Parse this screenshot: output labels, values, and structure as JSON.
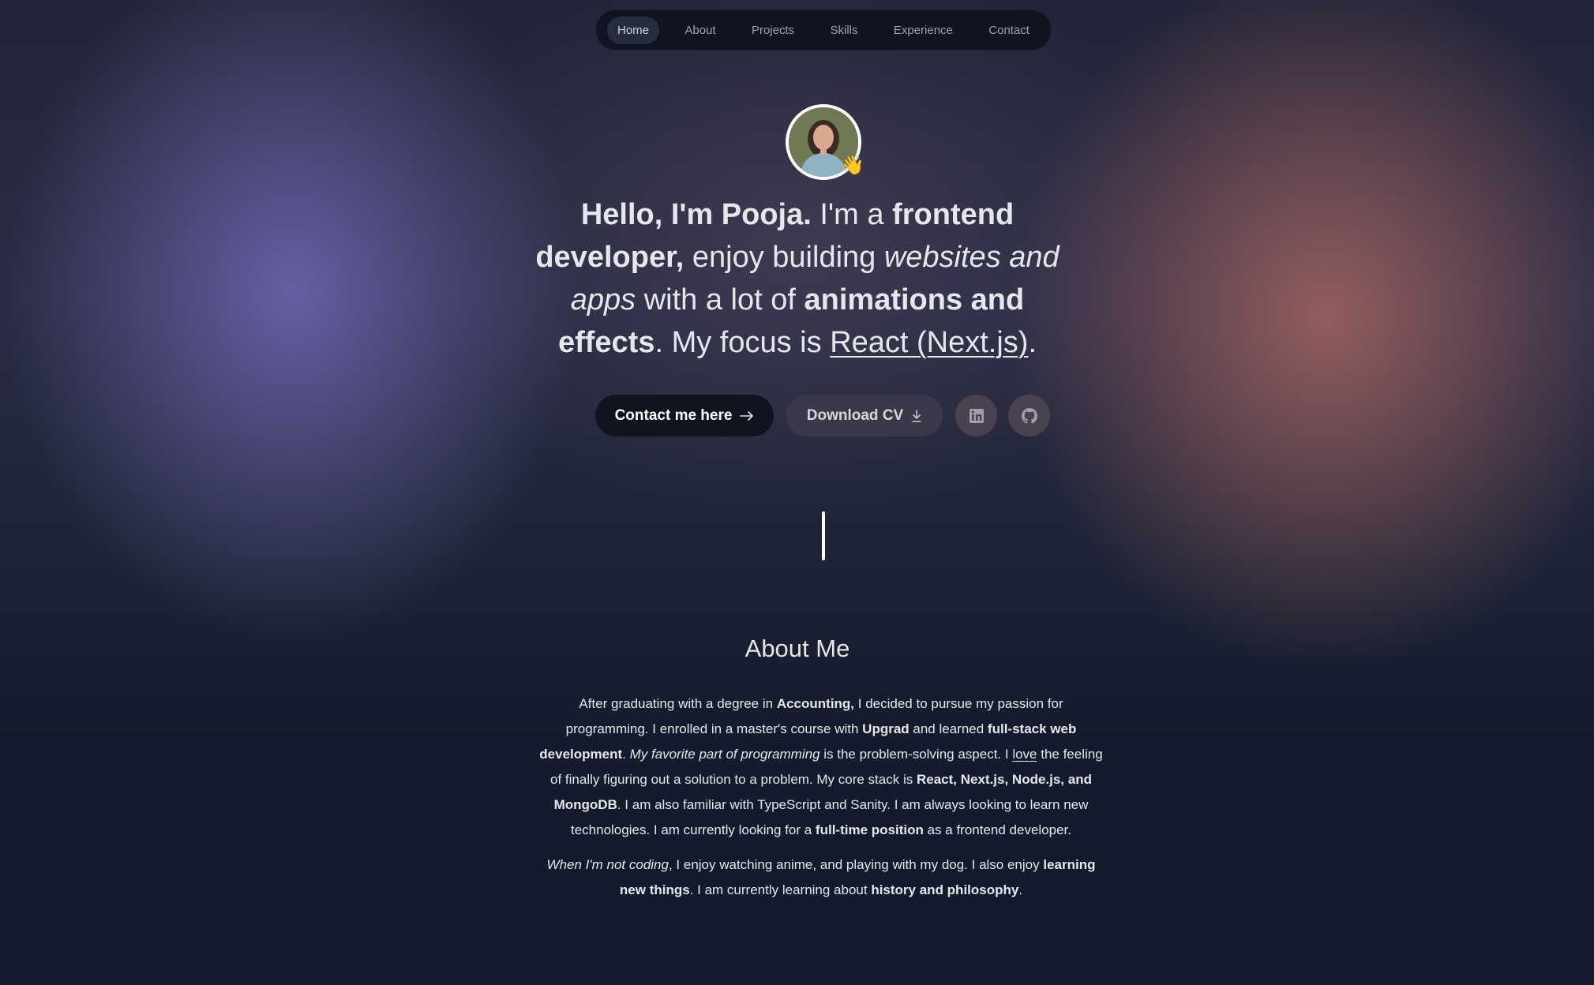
{
  "nav": {
    "items": [
      {
        "label": "Home",
        "active": true
      },
      {
        "label": "About"
      },
      {
        "label": "Projects"
      },
      {
        "label": "Skills"
      },
      {
        "label": "Experience"
      },
      {
        "label": "Contact"
      }
    ]
  },
  "avatar": {
    "badge_emoji": "👋"
  },
  "hero": {
    "greeting": "Hello, I'm Pooja.",
    "t1": " I'm a ",
    "role": "frontend developer,",
    "t2": " enjoy building ",
    "what": "websites and apps",
    "t3": " with a lot of ",
    "extras": "animations and effects",
    "t4": ". My focus is ",
    "focus": "React (Next.js)",
    "t5": "."
  },
  "buttons": {
    "contact_label": "Contact me here",
    "contact_icon": "arrow-right-icon",
    "cv_label": "Download CV",
    "cv_icon": "download-icon",
    "linkedin_icon": "linkedin-icon",
    "github_icon": "github-icon"
  },
  "about": {
    "title": "About Me",
    "p1": {
      "s1": "After graduating with a degree in ",
      "b1": "Accounting,",
      "s2": " I decided to pursue my passion for programming. I enrolled in a master's course with ",
      "b2": "Upgrad",
      "s3": " and learned ",
      "b3": "full-stack web development",
      "s4": ". ",
      "i1": "My favorite part of programming",
      "s5": " is the problem-solving aspect. I ",
      "u1": "love",
      "s6": " the feeling of finally figuring out a solution to a problem. My core stack is ",
      "b4": "React, Next.js, Node.js, and MongoDB",
      "s7": ". I am also familiar with TypeScript and Sanity. I am always looking to learn new technologies. I am currently looking for a ",
      "b5": "full-time position",
      "s8": " as a frontend developer."
    },
    "p2": {
      "i1": "When I'm not coding",
      "s1": ", I enjoy watching anime, and playing with my dog. I also enjoy ",
      "b1": "learning new things",
      "s2": ". I am currently learning about ",
      "b2": "history and philosophy",
      "s3": "."
    }
  },
  "colors": {
    "background": "#121a2b",
    "nav_bg": "#0f1420",
    "primary_button": "#0f1420",
    "text": "#e5e7eb"
  }
}
